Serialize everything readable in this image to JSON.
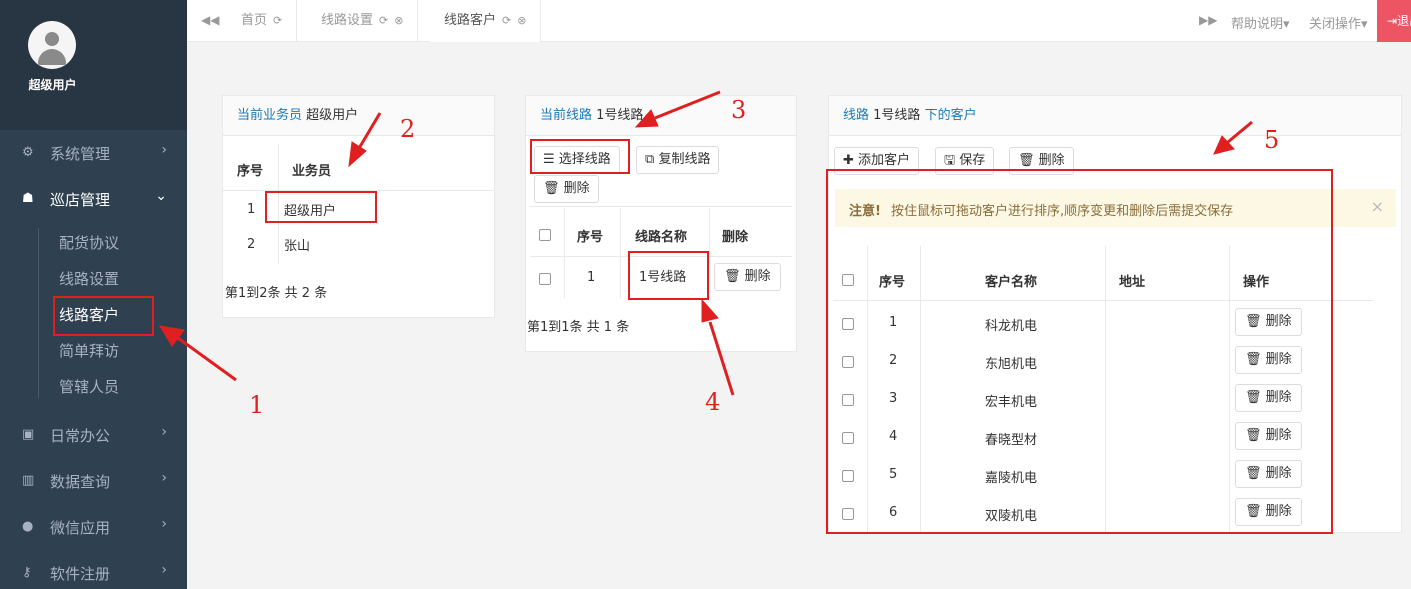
{
  "user": {
    "name": "超级用户"
  },
  "sidebar": {
    "items": [
      {
        "label": "系统管理",
        "icon": "gears-icon"
      },
      {
        "label": "巡店管理",
        "icon": "sitemap-icon"
      },
      {
        "label": "日常办公",
        "icon": "briefcase-icon"
      },
      {
        "label": "数据查询",
        "icon": "bar-chart-icon"
      },
      {
        "label": "微信应用",
        "icon": "wechat-icon"
      },
      {
        "label": "软件注册",
        "icon": "key-icon"
      }
    ],
    "sub_items": [
      "配货协议",
      "线路设置",
      "线路客户",
      "简单拜访",
      "管辖人员"
    ]
  },
  "tabs": [
    "首页",
    "线路设置",
    "线路客户"
  ],
  "topbar": {
    "help": "帮助说明",
    "close_ops": "关闭操作",
    "logout": "退出"
  },
  "panel1": {
    "prefix": "当前业务员",
    "value": "超级用户",
    "headers": [
      "序号",
      "业务员"
    ],
    "rows": [
      {
        "no": "1",
        "name": "超级用户"
      },
      {
        "no": "2",
        "name": "张山"
      }
    ],
    "footer": "第1到2条 共 2 条"
  },
  "panel2": {
    "prefix": "当前线路",
    "value": "1号线路",
    "btn_select": "选择线路",
    "btn_copy": "复制线路",
    "btn_delete": "删除",
    "headers": [
      "序号",
      "线路名称",
      "删除"
    ],
    "rows": [
      {
        "no": "1",
        "name": "1号线路",
        "action": "删除"
      }
    ],
    "footer": "第1到1条 共 1 条"
  },
  "panel3": {
    "prefix": "线路",
    "value": "1号线路",
    "suffix": "下的客户",
    "btn_add": "添加客户",
    "btn_save": "保存",
    "btn_delete": "删除",
    "alert_strong": "注意!",
    "alert_text": "按住鼠标可拖动客户进行排序,顺序变更和删除后需提交保存",
    "headers": [
      "序号",
      "客户名称",
      "地址",
      "操作"
    ],
    "rows": [
      {
        "no": "1",
        "name": "科龙机电",
        "address": "",
        "action": "删除"
      },
      {
        "no": "2",
        "name": "东旭机电",
        "address": "",
        "action": "删除"
      },
      {
        "no": "3",
        "name": "宏丰机电",
        "address": "",
        "action": "删除"
      },
      {
        "no": "4",
        "name": "春晓型材",
        "address": "",
        "action": "删除"
      },
      {
        "no": "5",
        "name": "嘉陵机电",
        "address": "",
        "action": "删除"
      },
      {
        "no": "6",
        "name": "双陵机电",
        "address": "",
        "action": "删除"
      }
    ]
  },
  "annotations": [
    "1",
    "2",
    "3",
    "4",
    "5"
  ],
  "colors": {
    "sidebar": "#2f4050",
    "link": "#1a7bb9",
    "annotation": "#e02020",
    "logout": "#ed5565"
  }
}
